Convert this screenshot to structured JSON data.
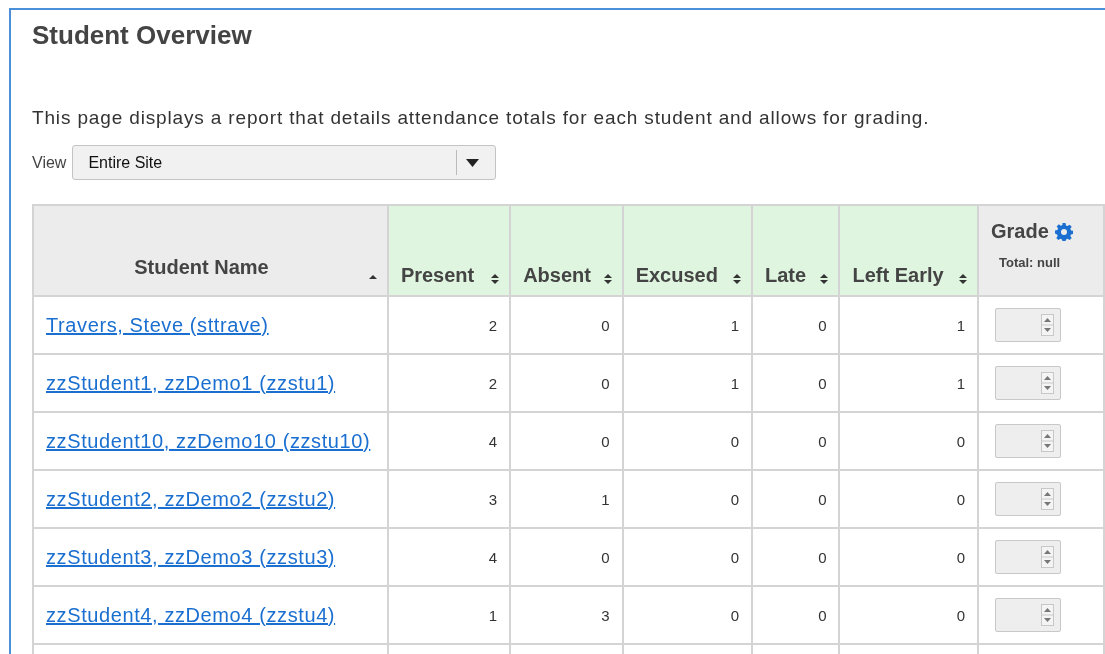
{
  "page": {
    "title": "Student Overview",
    "description": "This page displays a report that details attendance totals for each student and allows for grading."
  },
  "view": {
    "label": "View",
    "value": "Entire Site"
  },
  "table": {
    "columns": [
      {
        "label": "Student Name",
        "kind": "name",
        "sorted": true
      },
      {
        "label": "Present",
        "kind": "count",
        "sorted": false
      },
      {
        "label": "Absent",
        "kind": "count",
        "sorted": false
      },
      {
        "label": "Excused",
        "kind": "count",
        "sorted": false
      },
      {
        "label": "Late",
        "kind": "count",
        "sorted": false
      },
      {
        "label": "Left Early",
        "kind": "count",
        "sorted": false
      },
      {
        "label": "Grade",
        "kind": "grade",
        "subtitle": "Total: null"
      }
    ],
    "rows": [
      {
        "name": "Travers, Steve (sttrave)",
        "counts": [
          "2",
          "0",
          "1",
          "0",
          "1"
        ]
      },
      {
        "name": "zzStudent1, zzDemo1 (zzstu1)",
        "counts": [
          "2",
          "0",
          "1",
          "0",
          "1"
        ]
      },
      {
        "name": "zzStudent10, zzDemo10 (zzstu10)",
        "counts": [
          "4",
          "0",
          "0",
          "0",
          "0"
        ]
      },
      {
        "name": "zzStudent2, zzDemo2 (zzstu2)",
        "counts": [
          "3",
          "1",
          "0",
          "0",
          "0"
        ]
      },
      {
        "name": "zzStudent3, zzDemo3 (zzstu3)",
        "counts": [
          "4",
          "0",
          "0",
          "0",
          "0"
        ]
      },
      {
        "name": "zzStudent4, zzDemo4 (zzstu4)",
        "counts": [
          "1",
          "3",
          "0",
          "0",
          "0"
        ]
      }
    ]
  }
}
